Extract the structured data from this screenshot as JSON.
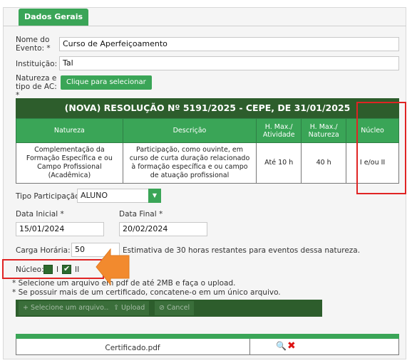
{
  "tab": {
    "label": "Dados Gerais"
  },
  "form": {
    "nome_label": "Nome do Evento: *",
    "nome_value": "Curso de Aperfeiçoamento",
    "instituicao_label": "Instituição: *",
    "instituicao_value": "Tal",
    "natureza_label": "Natureza e tipo de AC: *",
    "select_button": "Clique para selecionar"
  },
  "resolution": {
    "title": "(NOVA) RESOLUÇÃO Nº 5191/2025 - CEPE, DE 31/01/2025",
    "headers": [
      "Natureza",
      "Descrição",
      "H. Max./ Atividade",
      "H. Max./ Natureza",
      "Núcleo"
    ],
    "row": {
      "natureza": "Complementação da Formação Específica e ou Campo Profissional (Acadêmica)",
      "descricao": "Participação, como ouvinte, em curso de curta duração relacionado à formação específica e ou campo de atuação profissional",
      "h_atividade": "Até 10 h",
      "h_natureza": "40 h",
      "nucleo": "I e/ou II"
    }
  },
  "participacao": {
    "label": "Tipo Participação:",
    "value": "ALUNO",
    "arrow": "▼"
  },
  "dates": {
    "inicial_label": "Data Inicial *",
    "inicial_value": "15/01/2024",
    "final_label": "Data Final *",
    "final_value": "20/02/2024"
  },
  "carga": {
    "label": "Carga Horária: *",
    "value": "50",
    "hint": "Estimativa de 30 horas restantes para eventos dessa natureza."
  },
  "nucleo": {
    "label": "Núcleo:",
    "opt1": "I",
    "opt2": "II",
    "opt1_checked": false,
    "opt2_checked": true
  },
  "notes": {
    "line1": "* Selecione um arquivo em pdf de até 2MB e faça o upload.",
    "line2": "* Se possuir mais de um certificado, concatene-o em um único arquivo."
  },
  "upload": {
    "select": "+ Selecione um arquivo...",
    "upload": "⇪ Upload",
    "cancel": "⊘ Cancel"
  },
  "file": {
    "name": "Certificado.pdf",
    "view_icon": "🔍",
    "delete_icon": "✖"
  },
  "colors": {
    "green": "#3aa557",
    "dark_green": "#2d5d2c",
    "red_highlight": "#e02424",
    "arrow_orange": "#f28a2e"
  }
}
